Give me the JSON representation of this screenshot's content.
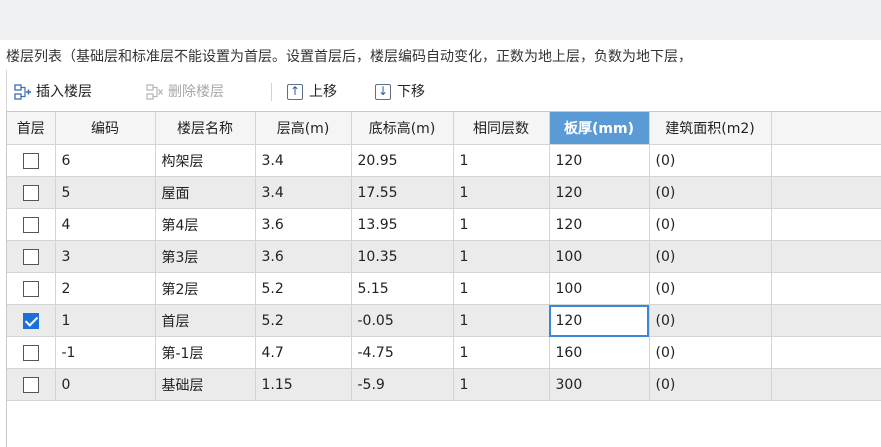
{
  "description": "楼层列表（基础层和标准层不能设置为首层。设置首层后，楼层编码自动变化，正数为地上层，负数为地下层，",
  "toolbar": {
    "insert_label": "插入楼层",
    "delete_label": "删除楼层",
    "up_label": "上移",
    "down_label": "下移"
  },
  "table": {
    "headers": {
      "first": "首层",
      "code": "编码",
      "name": "楼层名称",
      "height": "层高(m)",
      "base_elev": "底标高(m)",
      "same_count": "相同层数",
      "slab": "板厚(mm)",
      "area": "建筑面积(m2)"
    },
    "selected_column": "板厚(mm)",
    "rows": [
      {
        "first": false,
        "code": "6",
        "name": "构架层",
        "height": "3.4",
        "base_elev": "20.95",
        "same_count": "1",
        "slab": "120",
        "area": "(0)"
      },
      {
        "first": false,
        "code": "5",
        "name": "屋面",
        "height": "3.4",
        "base_elev": "17.55",
        "same_count": "1",
        "slab": "120",
        "area": "(0)"
      },
      {
        "first": false,
        "code": "4",
        "name": "第4层",
        "height": "3.6",
        "base_elev": "13.95",
        "same_count": "1",
        "slab": "120",
        "area": "(0)"
      },
      {
        "first": false,
        "code": "3",
        "name": "第3层",
        "height": "3.6",
        "base_elev": "10.35",
        "same_count": "1",
        "slab": "100",
        "area": "(0)"
      },
      {
        "first": false,
        "code": "2",
        "name": "第2层",
        "height": "5.2",
        "base_elev": "5.15",
        "same_count": "1",
        "slab": "100",
        "area": "(0)"
      },
      {
        "first": true,
        "code": "1",
        "name": "首层",
        "height": "5.2",
        "base_elev": "-0.05",
        "same_count": "1",
        "slab": "120",
        "area": "(0)"
      },
      {
        "first": false,
        "code": "-1",
        "name": "第-1层",
        "height": "4.7",
        "base_elev": "-4.75",
        "same_count": "1",
        "slab": "160",
        "area": "(0)"
      },
      {
        "first": false,
        "code": "0",
        "name": "基础层",
        "height": "1.15",
        "base_elev": "-5.9",
        "same_count": "1",
        "slab": "300",
        "area": "(0)"
      }
    ]
  },
  "colors": {
    "accent": "#5b9bd5",
    "checkbox_on": "#1e6fd9",
    "row_alt": "#ebebeb"
  },
  "icons": {
    "insert": "insert-floor-icon",
    "delete": "delete-floor-icon",
    "up": "arrow-up-icon",
    "down": "arrow-down-icon"
  }
}
